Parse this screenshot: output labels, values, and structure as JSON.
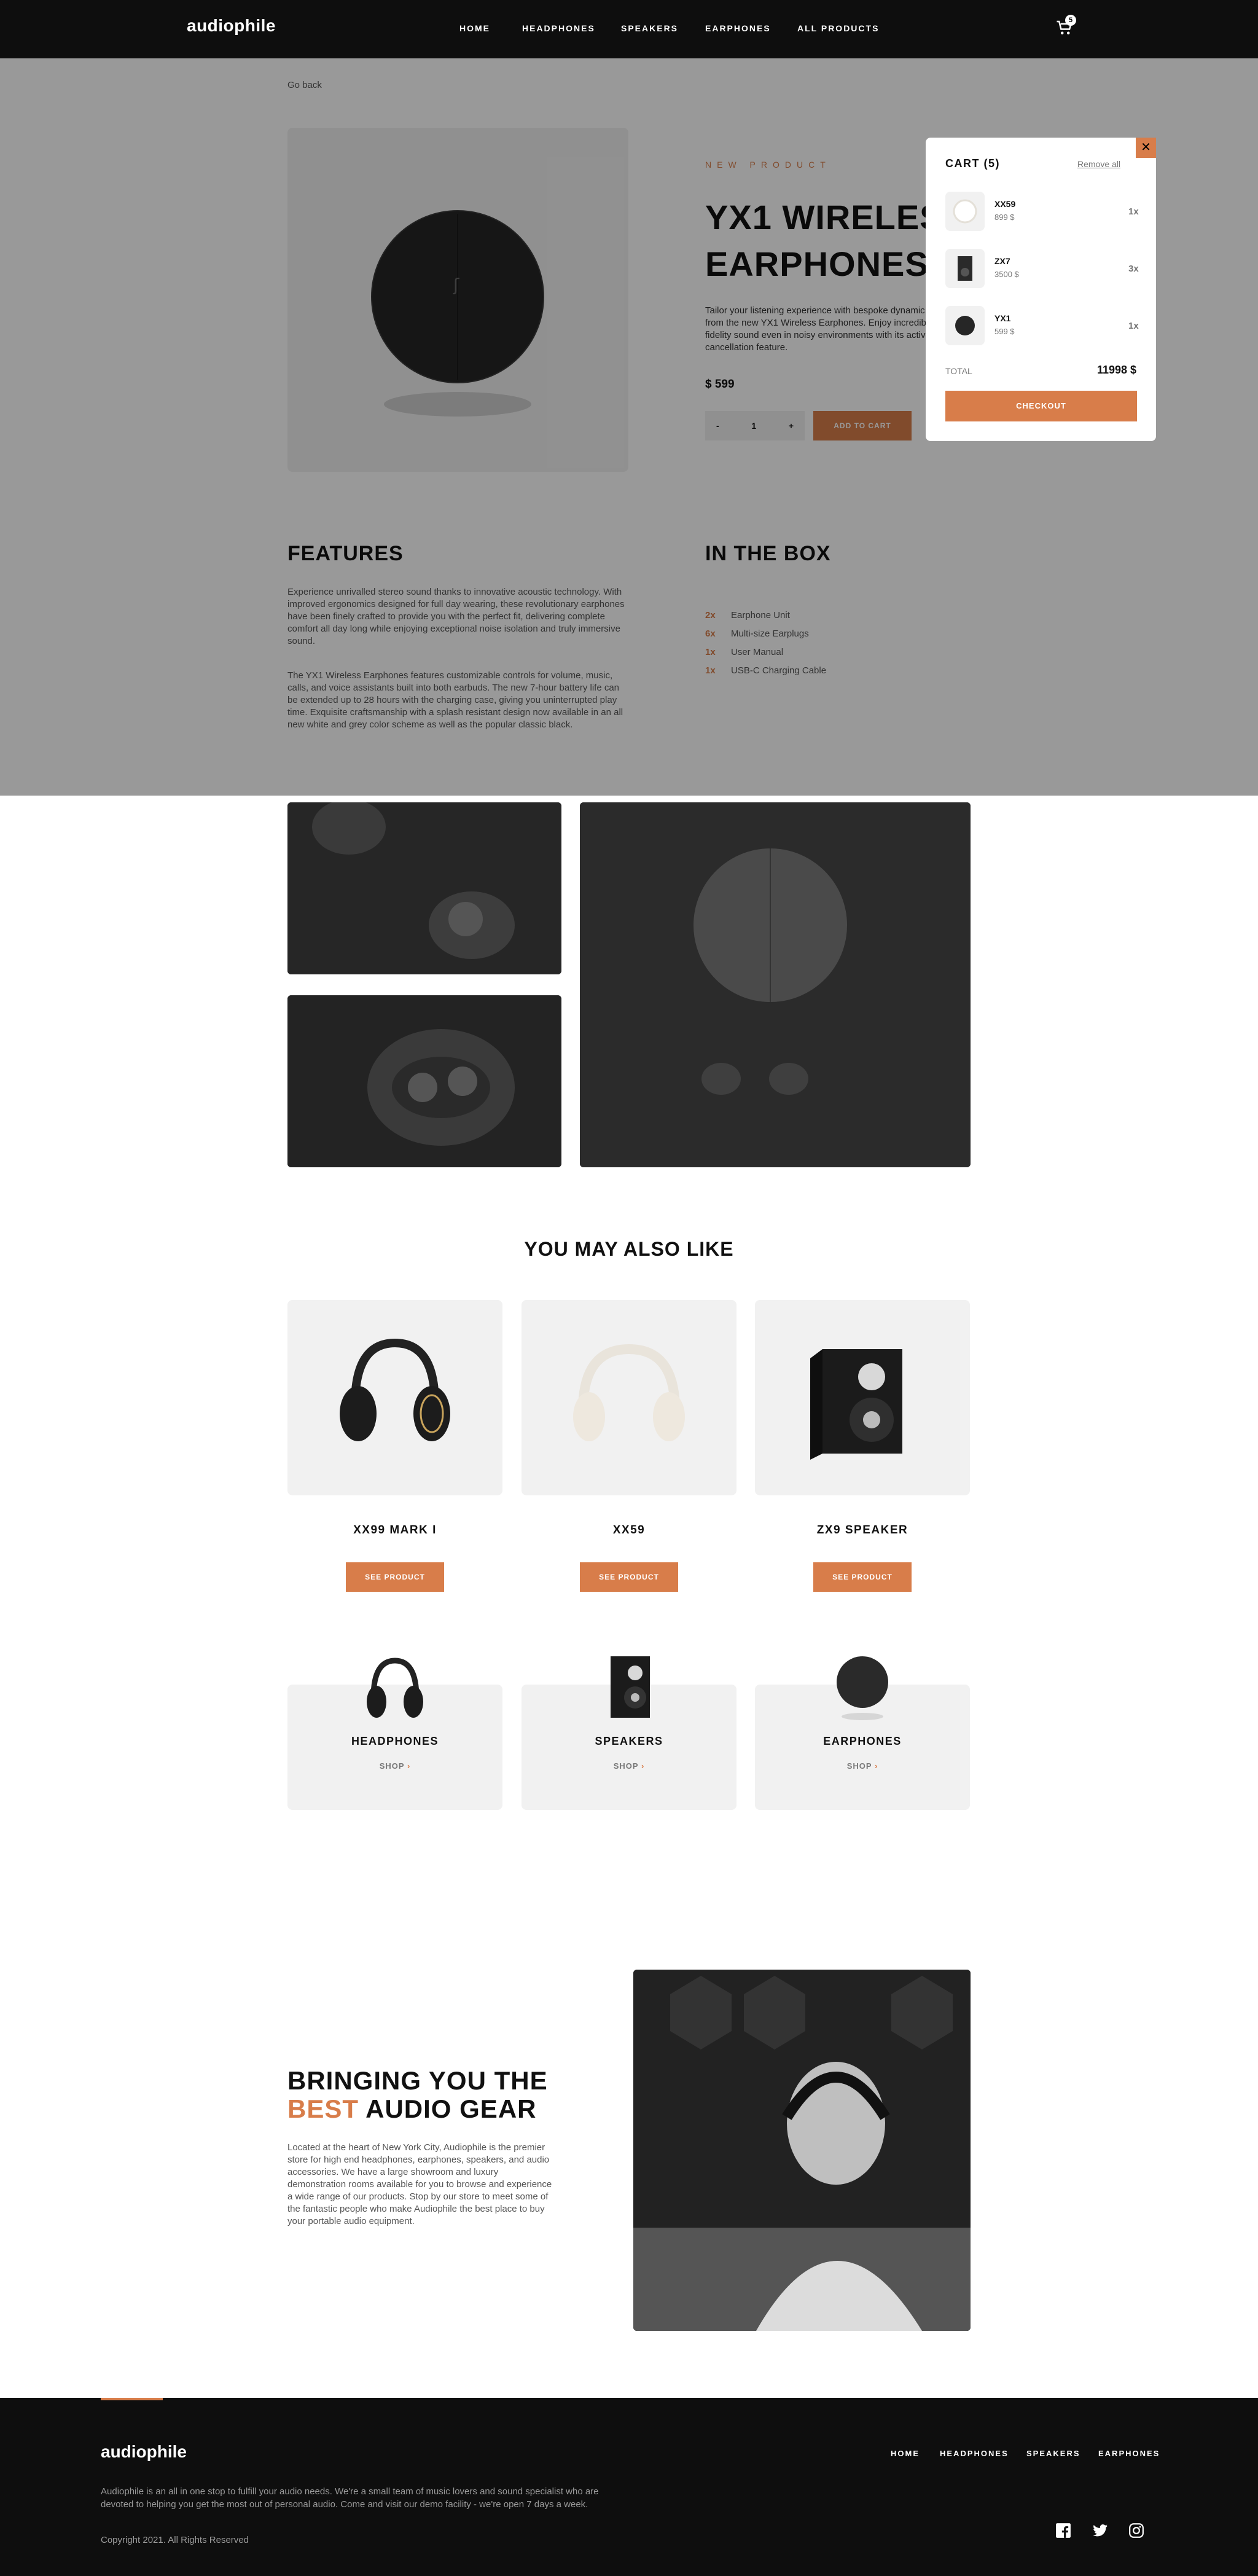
{
  "header": {
    "logo": "audiophile",
    "nav": [
      "HOME",
      "HEADPHONES",
      "SPEAKERS",
      "EARPHONES",
      "ALL PRODUCTS"
    ],
    "cart_count": "5"
  },
  "product": {
    "go_back": "Go back",
    "overline": "NEW PRODUCT",
    "title": "YX1 WIRELESS EARPHONES",
    "description": "Tailor your listening experience with bespoke dynamic drivers from the new YX1 Wireless Earphones. Enjoy incredible high-fidelity sound even in noisy environments with its active noise cancellation feature.",
    "price": "$ 599",
    "qty_minus": "-",
    "qty_value": "1",
    "qty_plus": "+",
    "add_to_cart": "ADD TO CART"
  },
  "features": {
    "title": "FEATURES",
    "p1": "Experience unrivalled stereo sound thanks to innovative acoustic technology. With improved ergonomics designed for full day wearing, these revolutionary earphones have been finely crafted to provide you with the perfect fit, delivering complete comfort all day long while enjoying exceptional noise isolation and truly immersive sound.",
    "p2": "The YX1 Wireless Earphones features customizable controls for volume, music, calls, and voice assistants built into both earbuds. The new 7-hour battery life can be extended up to 28 hours with the charging case, giving you uninterrupted play time. Exquisite craftsmanship with a splash resistant design now available in an all new white and grey color scheme as well as the popular classic black."
  },
  "in_the_box": {
    "title": "IN THE BOX",
    "items": [
      {
        "qty": "2x",
        "name": "Earphone Unit"
      },
      {
        "qty": "6x",
        "name": "Multi-size Earplugs"
      },
      {
        "qty": "1x",
        "name": "User Manual"
      },
      {
        "qty": "1x",
        "name": "USB-C Charging Cable"
      }
    ]
  },
  "also_like": {
    "title": "YOU MAY ALSO LIKE",
    "items": [
      {
        "name": "XX99 MARK I",
        "button": "SEE PRODUCT"
      },
      {
        "name": "XX59",
        "button": "SEE PRODUCT"
      },
      {
        "name": "ZX9 SPEAKER",
        "button": "SEE PRODUCT"
      }
    ]
  },
  "categories": [
    {
      "name": "HEADPHONES",
      "shop": "SHOP"
    },
    {
      "name": "SPEAKERS",
      "shop": "SHOP"
    },
    {
      "name": "EARPHONES",
      "shop": "SHOP"
    }
  ],
  "about": {
    "title_a": "BRINGING YOU THE",
    "title_accent": "BEST",
    "title_b": "AUDIO GEAR",
    "description": "Located at the heart of New York City, Audiophile is the premier store for high end headphones, earphones, speakers, and audio accessories. We have a large showroom and luxury demonstration rooms available for you to browse and experience a wide range of our products. Stop by our store to meet some of the fantastic people who make Audiophile the best place to buy your portable audio equipment."
  },
  "footer": {
    "logo": "audiophile",
    "nav": [
      "HOME",
      "HEADPHONES",
      "SPEAKERS",
      "EARPHONES"
    ],
    "description": "Audiophile is an all in one stop to fulfill your audio needs. We're a small team of music lovers and sound specialist who are devoted to helping you get the most out of personal audio. Come and visit our demo facility - we're open 7 days a week.",
    "copyright": "Copyright 2021. All Rights Reserved",
    "social_icons": [
      "facebook-icon",
      "twitter-icon",
      "instagram-icon"
    ]
  },
  "cart": {
    "title": "CART (5)",
    "remove_all": "Remove all",
    "items": [
      {
        "name": "XX59",
        "price": "899 $",
        "qty": "1x"
      },
      {
        "name": "ZX7",
        "price": "3500 $",
        "qty": "3x"
      },
      {
        "name": "YX1",
        "price": "599 $",
        "qty": "1x"
      }
    ],
    "total_label": "TOTAL",
    "total_value": "11998 $",
    "checkout": "CHECKOUT",
    "close": "✕"
  },
  "colors": {
    "accent": "#d87d4a",
    "dark": "#0e0e0e",
    "light": "#f1f1f1"
  }
}
